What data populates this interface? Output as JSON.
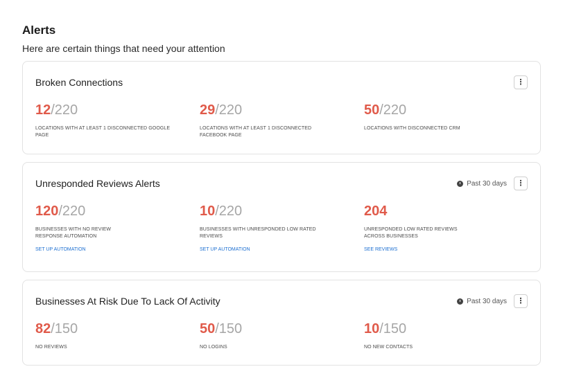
{
  "header": {
    "title": "Alerts",
    "subtitle": "Here are certain things that need your attention"
  },
  "icons": {
    "more": "vertical-ellipsis",
    "clock": "clock-icon"
  },
  "colors": {
    "accent_red": "#e05a4a",
    "link_blue": "#1d6fd1",
    "muted": "#a6a6a6"
  },
  "cards": [
    {
      "title": "Broken Connections",
      "more": "⋮",
      "metrics": [
        {
          "value": "12",
          "total": "/220",
          "desc": "LOCATIONS WITH AT LEAST 1 DISCONNECTED GOOGLE PAGE"
        },
        {
          "value": "29",
          "total": "/220",
          "desc": "LOCATIONS WITH AT LEAST 1 DISCONNECTED FACEBOOK PAGE"
        },
        {
          "value": "50",
          "total": "/220",
          "desc": "LOCATIONS WITH DISCONNECTED CRM"
        }
      ]
    },
    {
      "title": "Unresponded Reviews Alerts",
      "period": "Past 30 days",
      "more": "⋮",
      "metrics": [
        {
          "value": "120",
          "total": "/220",
          "desc": "BUSINESSES WITH NO REVIEW RESPONSE AUTOMATION",
          "link": "SET UP AUTOMATION"
        },
        {
          "value": "10",
          "total": "/220",
          "desc": "BUSINESSES WITH UNRESPONDED LOW RATED REVIEWS",
          "link": "SET UP AUTOMATION"
        },
        {
          "value": "204",
          "total": "",
          "desc": "UNRESPONDED LOW RATED REVIEWS ACROSS BUSINESSES",
          "link": "SEE REVIEWS"
        }
      ]
    },
    {
      "title": "Businesses At Risk Due To Lack Of Activity",
      "period": "Past 30 days",
      "more": "⋮",
      "metrics": [
        {
          "value": "82",
          "total": "/150",
          "desc": "NO REVIEWS"
        },
        {
          "value": "50",
          "total": "/150",
          "desc": "NO LOGINS"
        },
        {
          "value": "10",
          "total": "/150",
          "desc": "NO NEW CONTACTS"
        }
      ]
    }
  ]
}
